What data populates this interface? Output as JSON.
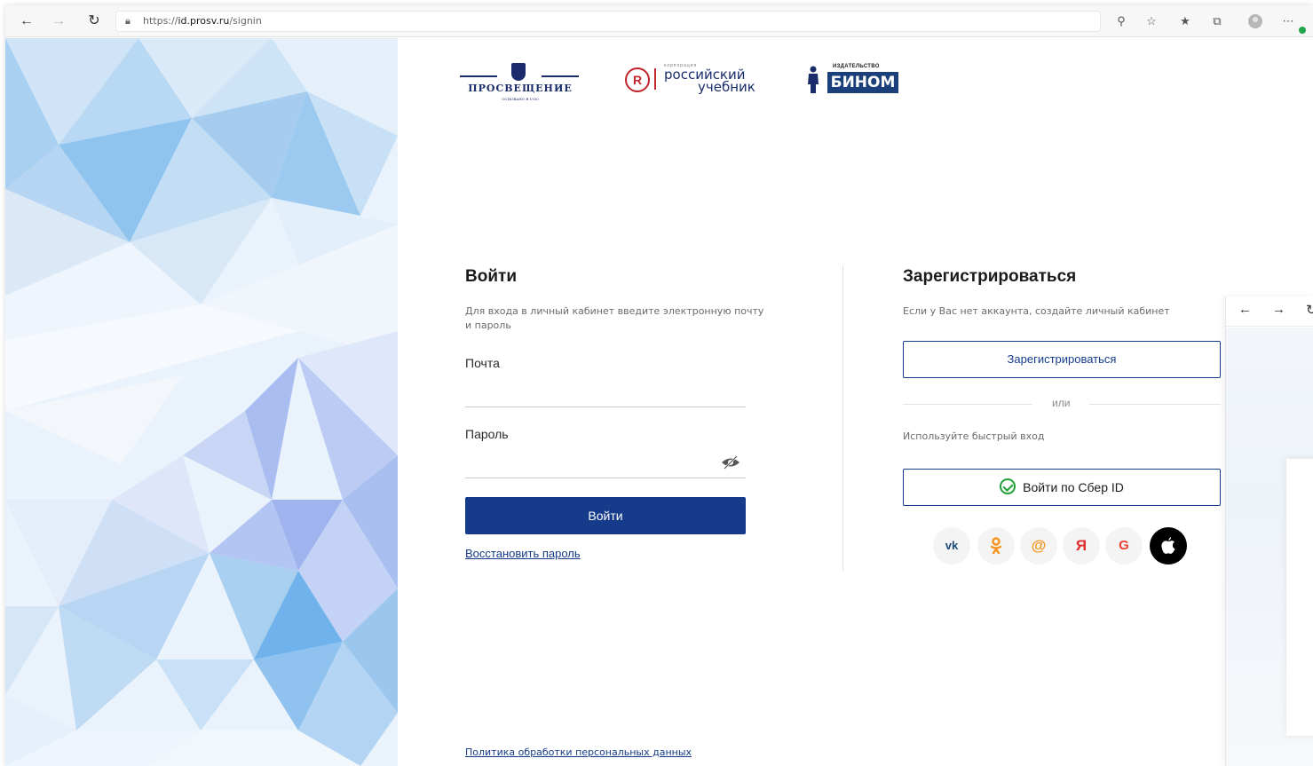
{
  "browser": {
    "url_prefix": "https://",
    "url_host": "id.prosv.ru",
    "url_path": "/signin",
    "icons": [
      "back-icon",
      "forward-icon",
      "refresh-icon",
      "lock-icon",
      "key-icon",
      "favorite-add-icon",
      "favorites-icon",
      "collections-icon",
      "profile-icon",
      "more-icon"
    ]
  },
  "logos": {
    "prosv_word": "ПРОСВЕЩЕНИЕ",
    "prosv_sub": "ОСНОВАНО В 1930",
    "ru_small": "корпорация",
    "ru_line1": "российский",
    "ru_line2": "учебник",
    "binom_small": "ИЗДАТЕЛЬСТВО",
    "binom_word": "БИНОМ"
  },
  "login": {
    "title": "Войти",
    "hint": "Для входа в личный кабинет введите электронную почту и пароль",
    "email_label": "Почта",
    "email_value": "",
    "password_label": "Пароль",
    "password_value": "",
    "submit": "Войти",
    "restore": "Восстановить пароль"
  },
  "register": {
    "title": "Зарегистрироваться",
    "hint": "Если у Вас нет аккаунта, создайте личный кабинет",
    "button": "Зарегистрироваться",
    "or": "или",
    "fast_login": "Используйте быстрый вход",
    "sber": "Войти по Сбер ID"
  },
  "socials": [
    {
      "name": "vk",
      "glyph": "vk",
      "color": "#1a4a7a"
    },
    {
      "name": "ok",
      "glyph": "ok",
      "color": "#f7931e"
    },
    {
      "name": "mail",
      "glyph": "@",
      "color": "#f7931e"
    },
    {
      "name": "yandex",
      "glyph": "Я",
      "color": "#e02d2d"
    },
    {
      "name": "google",
      "glyph": "G",
      "color": "#ea4335"
    },
    {
      "name": "apple",
      "glyph": "apple",
      "color": "#000000"
    }
  ],
  "footer": {
    "policy": "Политика обработки персональных данных"
  },
  "colors": {
    "primary": "#153b8a",
    "sber_green": "#21a038"
  }
}
